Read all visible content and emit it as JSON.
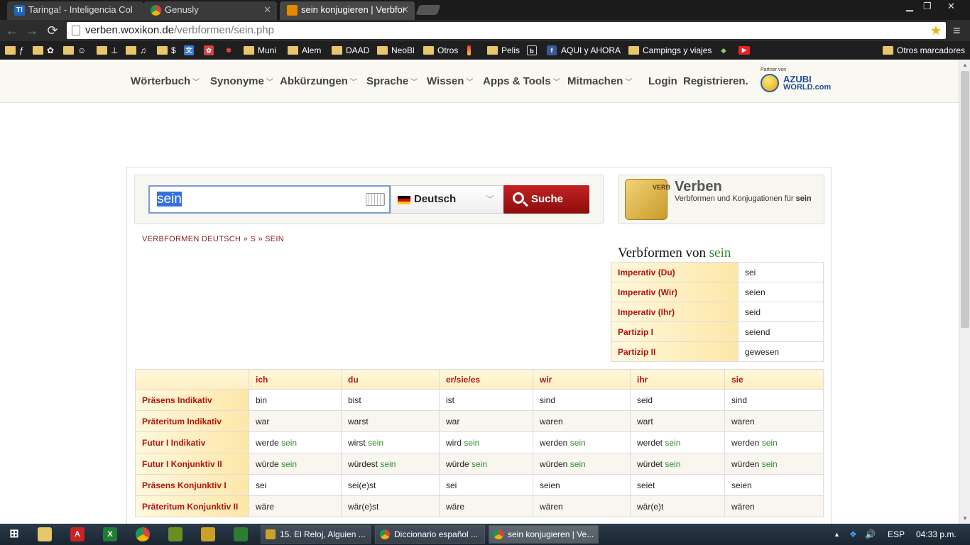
{
  "browser": {
    "tabs": [
      {
        "label": "Taringa! - Inteligencia Col",
        "icon": "taringa-icon"
      },
      {
        "label": "Genusly",
        "icon": "chrome-icon"
      },
      {
        "label": "sein konjugieren | Verbfor",
        "icon": "woxikon-icon",
        "active": true
      }
    ],
    "url_host": "verben.woxikon.de",
    "url_path": "/verbformen/sein.php",
    "window_controls": {
      "minimize": "▁",
      "restore": "❐",
      "close": "✕"
    },
    "bookmarks": [
      {
        "label": "ƒ",
        "type": "folder"
      },
      {
        "label": "✿",
        "type": "folder"
      },
      {
        "label": "☺",
        "type": "folder"
      },
      {
        "label": "⊥",
        "type": "folder"
      },
      {
        "label": "♫",
        "type": "folder"
      },
      {
        "label": "$",
        "type": "folder"
      },
      {
        "label": "",
        "type": "translate-icon"
      },
      {
        "label": "",
        "type": "photo-icon"
      },
      {
        "label": "",
        "type": "flower-icon"
      },
      {
        "label": "Muni",
        "type": "folder"
      },
      {
        "label": "Alem",
        "type": "folder"
      },
      {
        "label": "DAAD",
        "type": "folder"
      },
      {
        "label": "NeoBl",
        "type": "folder"
      },
      {
        "label": "Otros",
        "type": "folder"
      },
      {
        "label": "",
        "type": "bar-icon"
      },
      {
        "label": "Pelis",
        "type": "folder"
      },
      {
        "label": "",
        "type": "b-icon"
      },
      {
        "label": "AQUI y AHORA",
        "type": "facebook-icon"
      },
      {
        "label": "Campings y viajes",
        "type": "folder"
      },
      {
        "label": "",
        "type": "android-icon"
      },
      {
        "label": "",
        "type": "youtube-icon"
      }
    ],
    "other_bookmarks": "Otros marcadores"
  },
  "site": {
    "nav": [
      "Wörterbuch",
      "Synonyme",
      "Abkürzungen",
      "Sprache",
      "Wissen",
      "Apps & Tools",
      "Mitmachen"
    ],
    "login": "Login",
    "register": "Registrieren.",
    "partner": {
      "small": "Partner von",
      "line1": "AZUBI",
      "line2": "WORLD.com"
    }
  },
  "search": {
    "value": "sein",
    "language": "Deutsch",
    "button": "Suche"
  },
  "verb_box": {
    "title": "Verben",
    "subtitle_prefix": "Verbformen und Konjugationen für ",
    "subtitle_word": "sein",
    "book_text": "VERB"
  },
  "breadcrumb": "VERBFORMEN DEUTSCH » S » SEIN",
  "verbformen": {
    "heading_prefix": "Verbformen von ",
    "heading_word": "sein",
    "rows": [
      {
        "label": "Imperativ (Du)",
        "value": "sei"
      },
      {
        "label": "Imperativ (Wir)",
        "value": "seien"
      },
      {
        "label": "Imperativ (Ihr)",
        "value": "seid"
      },
      {
        "label": "Partizip I",
        "value": "seiend"
      },
      {
        "label": "Partizip II",
        "value": "gewesen"
      }
    ]
  },
  "conjugation": {
    "headers": [
      "",
      "ich",
      "du",
      "er/sie/es",
      "wir",
      "ihr",
      "sie"
    ],
    "rows": [
      {
        "tense": "Präsens Indikativ",
        "forms": [
          [
            "bin",
            ""
          ],
          [
            "bist",
            ""
          ],
          [
            "ist",
            ""
          ],
          [
            "sind",
            ""
          ],
          [
            "seid",
            ""
          ],
          [
            "sind",
            ""
          ]
        ]
      },
      {
        "tense": "Präteritum Indikativ",
        "forms": [
          [
            "war",
            ""
          ],
          [
            "warst",
            ""
          ],
          [
            "war",
            ""
          ],
          [
            "waren",
            ""
          ],
          [
            "wart",
            ""
          ],
          [
            "waren",
            ""
          ]
        ]
      },
      {
        "tense": "Futur I Indikativ",
        "forms": [
          [
            "werde ",
            "sein"
          ],
          [
            "wirst ",
            "sein"
          ],
          [
            "wird ",
            "sein"
          ],
          [
            "werden ",
            "sein"
          ],
          [
            "werdet ",
            "sein"
          ],
          [
            "werden ",
            "sein"
          ]
        ]
      },
      {
        "tense": "Futur I Konjunktiv II",
        "forms": [
          [
            "würde ",
            "sein"
          ],
          [
            "würdest ",
            "sein"
          ],
          [
            "würde ",
            "sein"
          ],
          [
            "würden ",
            "sein"
          ],
          [
            "würdet ",
            "sein"
          ],
          [
            "würden ",
            "sein"
          ]
        ]
      },
      {
        "tense": "Präsens Konjunktiv I",
        "forms": [
          [
            "sei",
            ""
          ],
          [
            "sei(e)st",
            ""
          ],
          [
            "sei",
            ""
          ],
          [
            "seien",
            ""
          ],
          [
            "seiet",
            ""
          ],
          [
            "seien",
            ""
          ]
        ]
      },
      {
        "tense": "Präteritum Konjunktiv II",
        "forms": [
          [
            "wäre",
            ""
          ],
          [
            "wär(e)st",
            ""
          ],
          [
            "wäre",
            ""
          ],
          [
            "wären",
            ""
          ],
          [
            "wär(e)t",
            ""
          ],
          [
            "wären",
            ""
          ]
        ]
      }
    ]
  },
  "taskbar": {
    "tasks": [
      "15. El Reloj,  Alguien ...",
      "Diccionario español ...",
      "sein konjugieren | Ve..."
    ],
    "lang": "ESP",
    "time": "04:33 p.m."
  },
  "colors": {
    "accent_red": "#b01515",
    "green": "#2e8b2e",
    "search_button": "#a81818"
  }
}
